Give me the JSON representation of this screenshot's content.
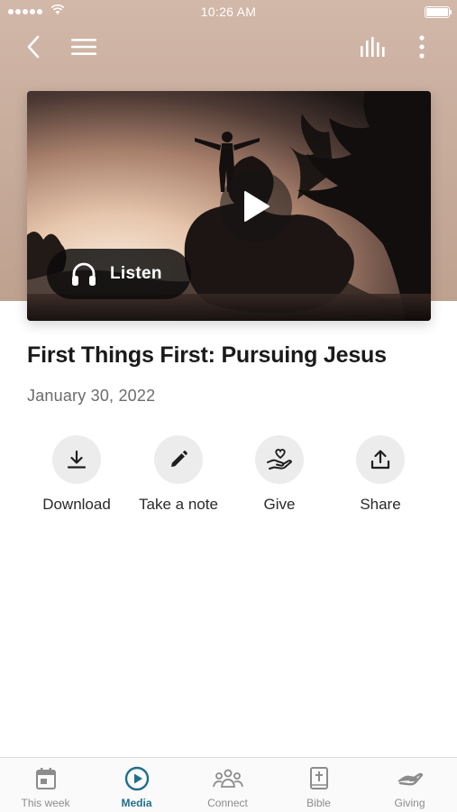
{
  "status_bar": {
    "time": "10:26 AM"
  },
  "sermon": {
    "title": "First Things First: Pursuing Jesus",
    "date": "January 30, 2022",
    "listen_label": "Listen"
  },
  "actions": [
    {
      "label": "Download",
      "icon": "download-icon"
    },
    {
      "label": "Take a note",
      "icon": "pencil-icon"
    },
    {
      "label": "Give",
      "icon": "give-heart-hand-icon"
    },
    {
      "label": "Share",
      "icon": "share-icon"
    }
  ],
  "tabs": [
    {
      "label": "This week",
      "icon": "calendar-icon",
      "active": false
    },
    {
      "label": "Media",
      "icon": "play-circle-icon",
      "active": true
    },
    {
      "label": "Connect",
      "icon": "people-icon",
      "active": false
    },
    {
      "label": "Bible",
      "icon": "bible-icon",
      "active": false
    },
    {
      "label": "Giving",
      "icon": "giving-hand-icon",
      "active": false
    }
  ],
  "colors": {
    "accent": "#1f6f8b",
    "hero_background": "#c9ae9e",
    "inactive_tab": "#8c8c8c"
  }
}
